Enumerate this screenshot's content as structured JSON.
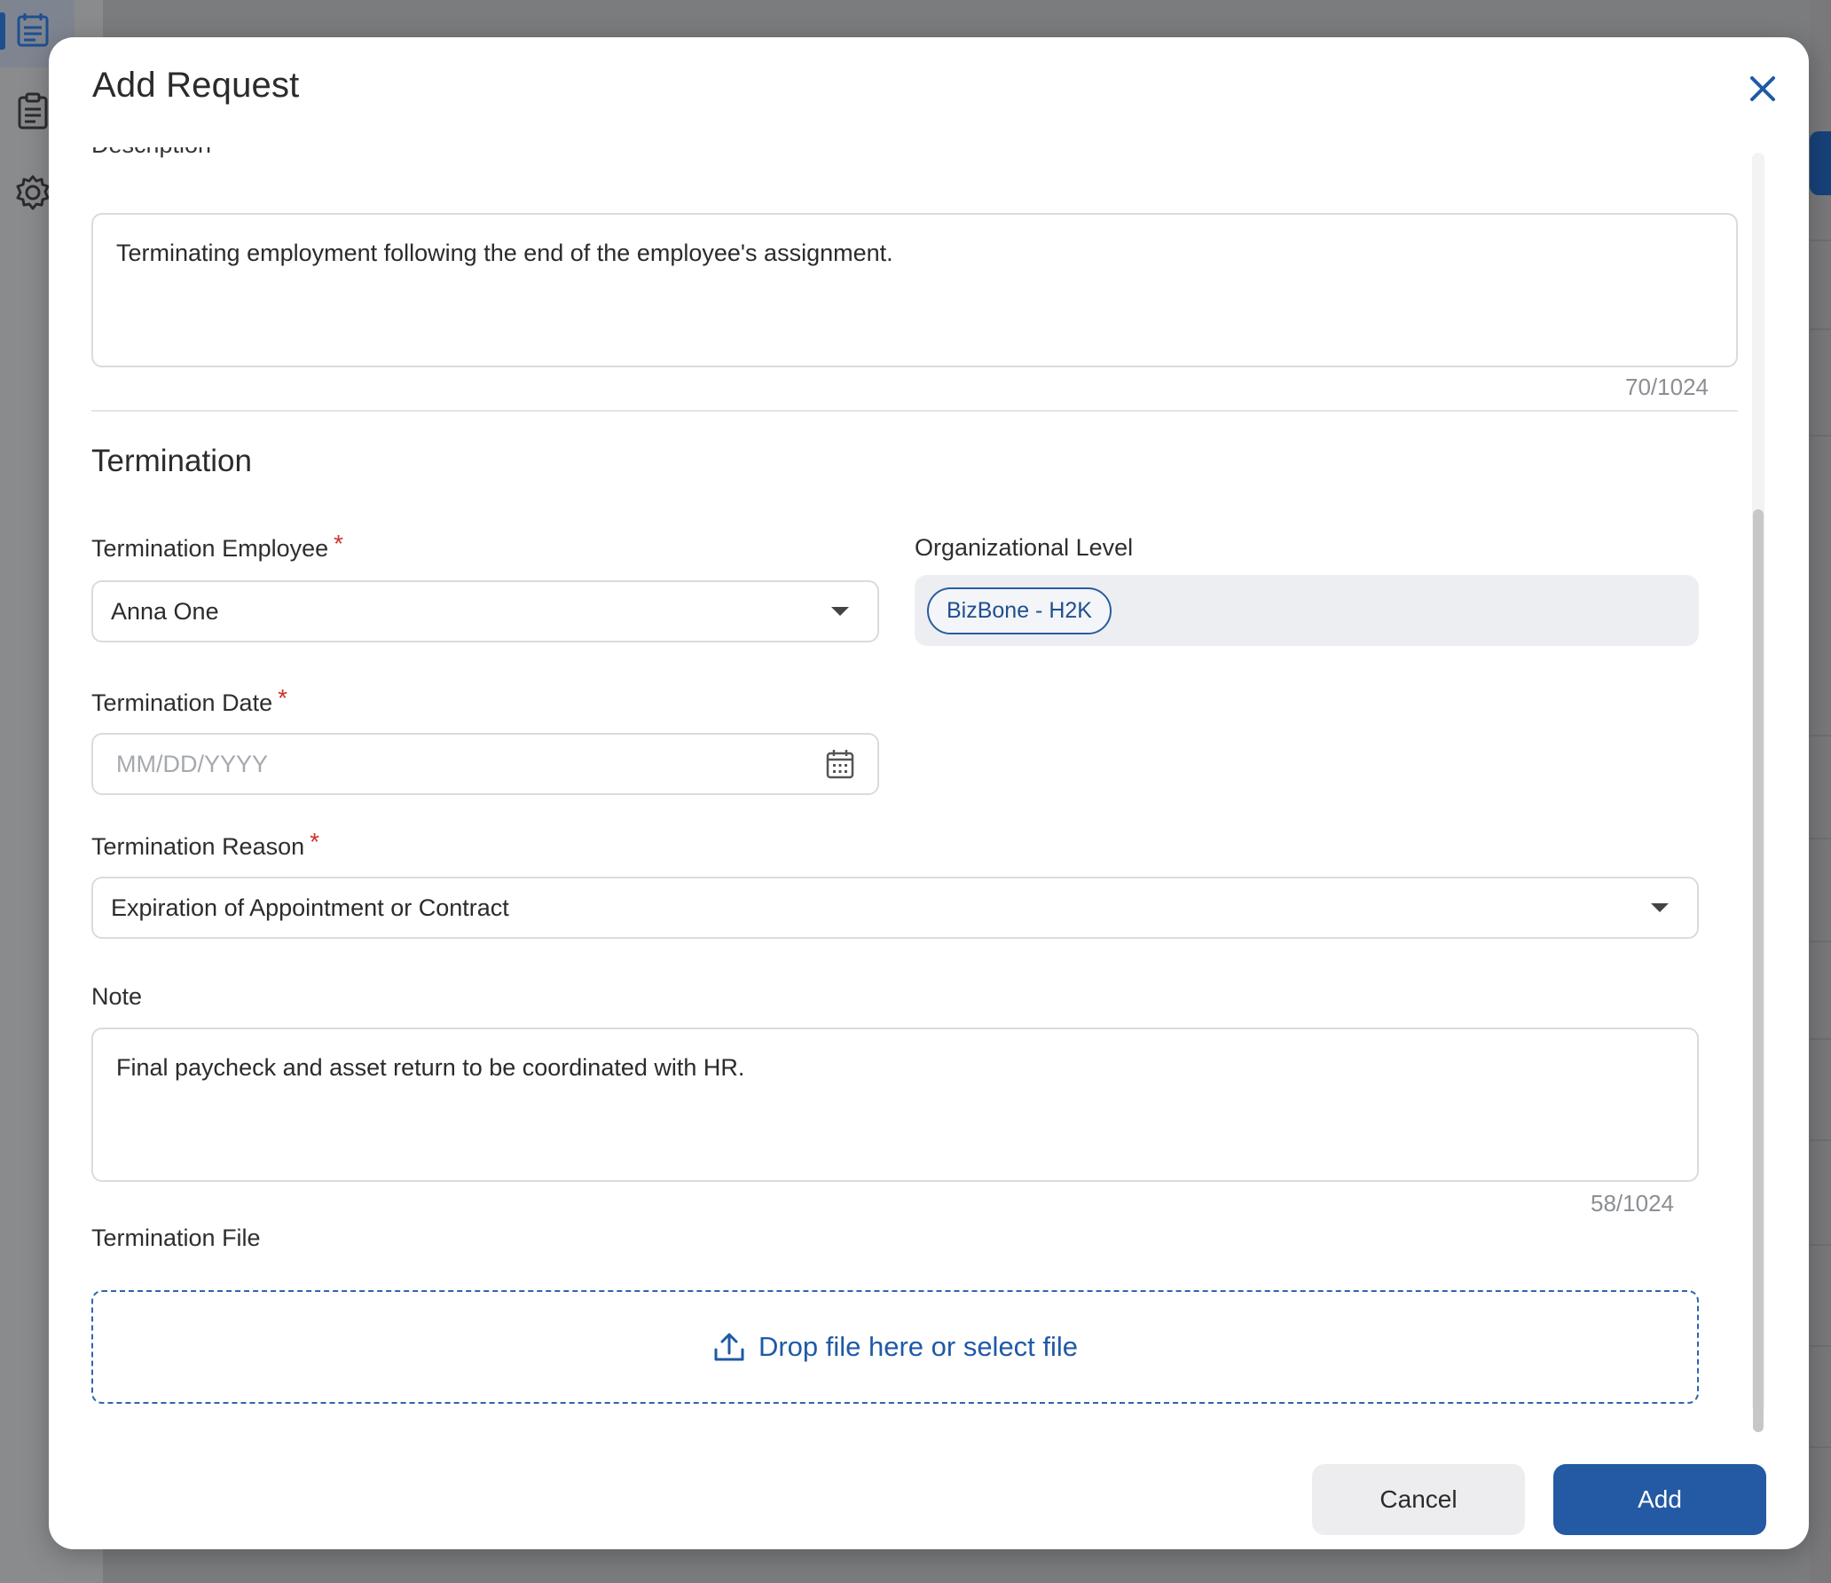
{
  "modal": {
    "title": "Add Request",
    "close_icon": "close-icon"
  },
  "description": {
    "label": "Description",
    "value": "Terminating employment following the end of the employee's assignment.",
    "counter": "70/1024"
  },
  "section": {
    "title": "Termination"
  },
  "termination_employee": {
    "label": "Termination Employee",
    "required_mark": "*",
    "value": "Anna One"
  },
  "organizational_level": {
    "label": "Organizational Level",
    "chip": "BizBone - H2K"
  },
  "termination_date": {
    "label": "Termination Date",
    "required_mark": "*",
    "placeholder": "MM/DD/YYYY",
    "icon": "calendar-icon"
  },
  "termination_reason": {
    "label": "Termination Reason",
    "required_mark": "*",
    "value": "Expiration of Appointment or Contract"
  },
  "note": {
    "label": "Note",
    "value": "Final paycheck and asset return to be coordinated with HR.",
    "counter": "58/1024"
  },
  "termination_file": {
    "label": "Termination File",
    "dropzone_text": "Drop file here or select file",
    "icon": "upload-icon"
  },
  "footer": {
    "cancel_label": "Cancel",
    "add_label": "Add"
  },
  "colors": {
    "primary": "#2459a3",
    "required": "#d0302a",
    "overlay": "#7b7c7e"
  }
}
